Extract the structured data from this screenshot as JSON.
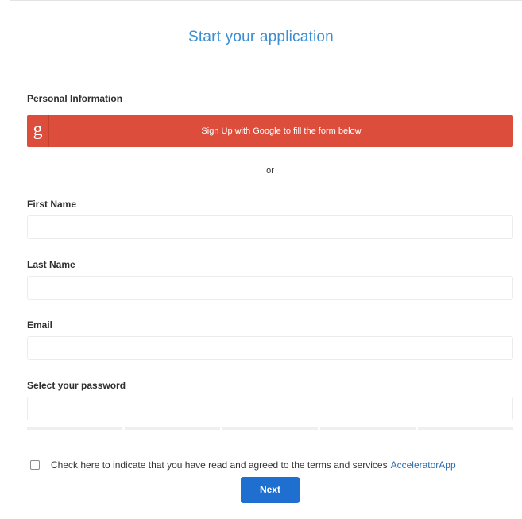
{
  "form": {
    "title": "Start your application",
    "section_label": "Personal Information",
    "google_button": {
      "icon_glyph": "g",
      "label": "Sign Up with Google to fill the form below",
      "color": "#dc4e3b"
    },
    "separator": "or",
    "fields": {
      "first_name": {
        "label": "First Name",
        "value": "",
        "placeholder": ""
      },
      "last_name": {
        "label": "Last Name",
        "value": "",
        "placeholder": ""
      },
      "email": {
        "label": "Email",
        "value": "",
        "placeholder": ""
      },
      "password": {
        "label": "Select your password",
        "value": "",
        "placeholder": ""
      }
    },
    "password_strength_segments": 5,
    "terms": {
      "checked": false,
      "text": "Check here to indicate that you have read and agreed to the terms and services",
      "link_text": "AcceleratorApp"
    },
    "next_button": {
      "label": "Next",
      "color": "#1f6fd0"
    },
    "accent_color": "#3b8ed3"
  }
}
